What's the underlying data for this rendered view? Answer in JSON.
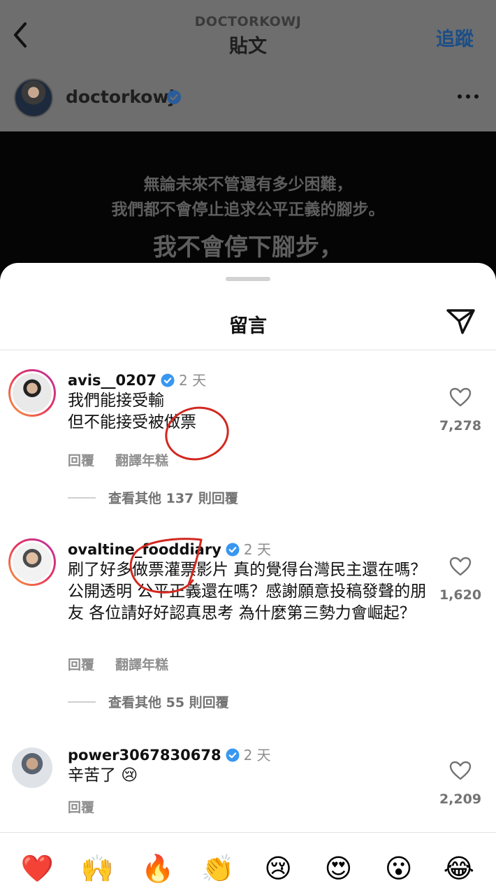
{
  "header": {
    "kicker": "DOCTORKOWJ",
    "title": "貼文",
    "follow_label": "追蹤"
  },
  "author": {
    "username": "doctorkowj"
  },
  "post_image": {
    "line1": "無論未來不管還有多少困難，",
    "line2": "我們都不會停止追求公平正義的腳步。",
    "line3": "我不會停下腳步，"
  },
  "sheet": {
    "title": "留言"
  },
  "comments": [
    {
      "username": "avis__0207",
      "time": "2 天",
      "text_lines": [
        "我們能接受輸",
        "但不能接受被做票"
      ],
      "likes": "7,278",
      "reply_label": "回覆",
      "translate_label": "翻譯年糕",
      "view_more": "查看其他 137 則回覆"
    },
    {
      "username": "ovaltine_fooddiary",
      "time": "2 天",
      "text": "刷了好多做票灌票影片 真的覺得台灣民主還在嗎？公開透明 公平正義還在嗎？感謝願意投稿發聲的朋友 各位請好好認真思考 為什麼第三勢力會崛起？",
      "likes": "1,620",
      "reply_label": "回覆",
      "translate_label": "翻譯年糕",
      "view_more": "查看其他 55 則回覆"
    },
    {
      "username": "power3067830678",
      "time": "2 天",
      "text": "辛苦了 😢",
      "likes": "2,209",
      "reply_label": "回覆"
    }
  ],
  "reactions": [
    "❤️",
    "🙌",
    "🔥",
    "👏",
    "😢",
    "😍",
    "😮",
    "😂"
  ],
  "colors": {
    "verified_blue": "#3897f0",
    "follow_blue": "#1c4e86",
    "annotation_red": "#d2281f"
  }
}
